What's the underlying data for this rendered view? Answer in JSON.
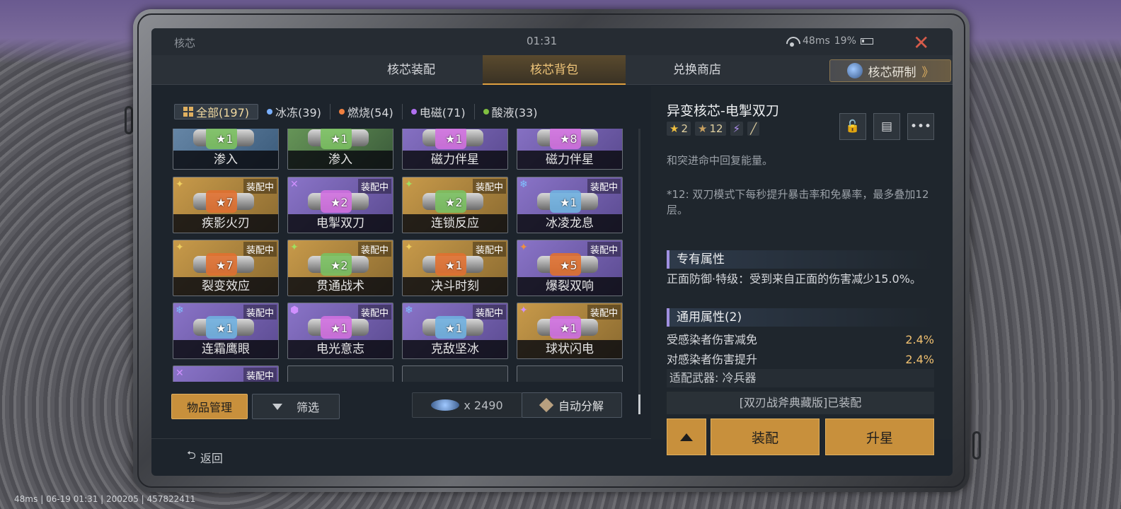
{
  "window": {
    "title": "核芯",
    "time": "01:31",
    "ping": "48ms",
    "battery": "19%"
  },
  "tabs": [
    {
      "label": "核芯装配",
      "active": false
    },
    {
      "label": "核芯背包",
      "active": true
    },
    {
      "label": "兑换商店",
      "active": false
    }
  ],
  "research_button": {
    "label": "核芯研制",
    "chevron": "》"
  },
  "filters": [
    {
      "label": "全部(197)",
      "icon": "grid-icon",
      "color": "#e0b060"
    },
    {
      "label": "冰冻(39)",
      "icon": "snowflake-icon",
      "color": "#7ab0ff"
    },
    {
      "label": "燃烧(54)",
      "icon": "fire-icon",
      "color": "#f08040"
    },
    {
      "label": "电磁(71)",
      "icon": "lightning-icon",
      "color": "#b070f0"
    },
    {
      "label": "酸液(33)",
      "icon": "acid-icon",
      "color": "#80c040"
    }
  ],
  "items_row0": [
    {
      "name": "渗入",
      "stars": "1",
      "color": "blue"
    },
    {
      "name": "渗入",
      "stars": "1",
      "color": "green"
    },
    {
      "name": "磁力伴星",
      "stars": "1",
      "color": "purple"
    },
    {
      "name": "磁力伴星",
      "stars": "8",
      "color": "purple"
    }
  ],
  "items": [
    {
      "name": "疾影火刃",
      "stars": "7",
      "badge": "装配中",
      "color": "gold"
    },
    {
      "name": "电掣双刀",
      "stars": "2",
      "badge": "装配中",
      "color": "purple"
    },
    {
      "name": "连锁反应",
      "stars": "2",
      "badge": "装配中",
      "color": "gold"
    },
    {
      "name": "冰凌龙息",
      "stars": "1",
      "badge": "装配中",
      "color": "purple"
    },
    {
      "name": "裂变效应",
      "stars": "7",
      "badge": "装配中",
      "color": "gold"
    },
    {
      "name": "贯通战术",
      "stars": "2",
      "badge": "装配中",
      "color": "gold"
    },
    {
      "name": "决斗时刻",
      "stars": "1",
      "badge": "装配中",
      "color": "gold"
    },
    {
      "name": "爆裂双响",
      "stars": "5",
      "badge": "装配中",
      "color": "purple"
    },
    {
      "name": "连霜鹰眼",
      "stars": "1",
      "badge": "装配中",
      "color": "purple"
    },
    {
      "name": "电光意志",
      "stars": "1",
      "badge": "装配中",
      "color": "purple"
    },
    {
      "name": "克敌坚冰",
      "stars": "1",
      "badge": "装配中",
      "color": "purple"
    },
    {
      "name": "球状闪电",
      "stars": "1",
      "badge": "装配中",
      "color": "gold"
    }
  ],
  "partial_item": {
    "badge": "装配中"
  },
  "bottom": {
    "manage": "物品管理",
    "filter": "筛选",
    "currency": "x 2490",
    "auto_dismantle": "自动分解",
    "back": "返回"
  },
  "detail": {
    "title": "异变核芯-电掣双刀",
    "star_a": "2",
    "star_b": "12",
    "desc1": "和突进命中回复能量。",
    "desc2": "*12: 双刀模式下每秒提升暴击率和免暴率，最多叠加12层。",
    "exclusive_header": "专有属性",
    "exclusive_text": "正面防御·特级：受到来自正面的伤害减少15.0%。",
    "common_header": "通用属性(2)",
    "stats": [
      {
        "label": "受感染者伤害减免",
        "value": "2.4%"
      },
      {
        "label": "对感染者伤害提升",
        "value": "2.4%"
      }
    ],
    "weapon": "适配武器: 冷兵器",
    "equipped": "[双刃战斧典藏版]已装配",
    "equip_btn": "装配",
    "upgrade_btn": "升星"
  },
  "statusbar": {
    "ping": "48ms",
    "info": "| 06-19 01:31 | 200205 | 457822411"
  }
}
